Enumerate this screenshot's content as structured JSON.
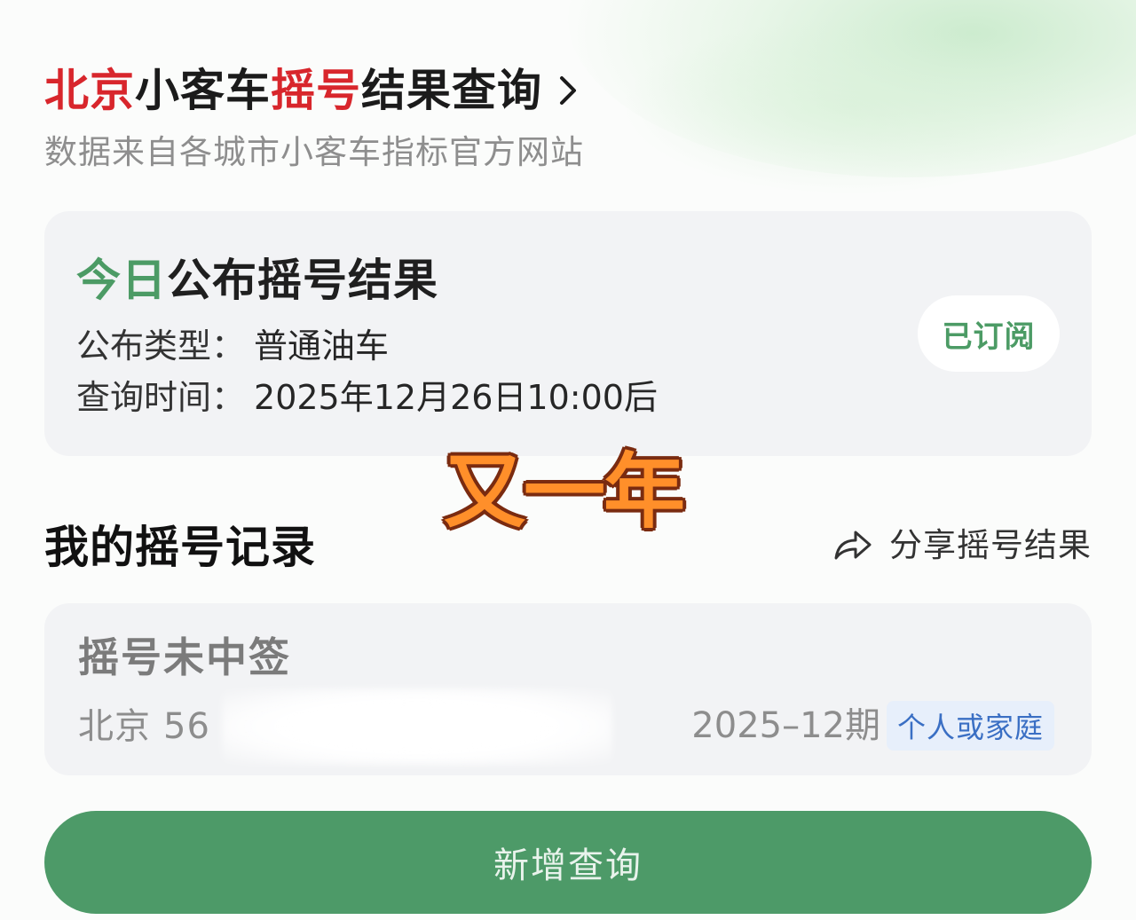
{
  "header": {
    "title_parts": [
      {
        "text": "北京",
        "color": "#d8262c"
      },
      {
        "text": "小客车",
        "color": "#1b1b1b"
      },
      {
        "text": "摇号",
        "color": "#d8262c"
      },
      {
        "text": "结果查询",
        "color": "#1b1b1b"
      }
    ],
    "subtitle": "数据来自各城市小客车指标官方网站"
  },
  "today": {
    "title_highlight": "今日",
    "title_rest": "公布摇号结果",
    "type_label": "公布类型：",
    "type_value": "普通油车",
    "time_label": "查询时间：",
    "time_value": "2025年12月26日10:00后",
    "subscribe_label": "已订阅"
  },
  "overlay": {
    "text": "又一年"
  },
  "records": {
    "title": "我的摇号记录",
    "share_label": "分享摇号结果",
    "items": [
      {
        "status": "摇号未中签",
        "city": "北京",
        "code_visible": "56",
        "period": "2025–12期",
        "tag": "个人或家庭"
      }
    ]
  },
  "actions": {
    "add_query_label": "新增查询"
  },
  "colors": {
    "accent_green": "#4c9b65",
    "accent_red": "#d8262c",
    "tag_blue": "#3a6fc4",
    "button_green": "#4d9a68"
  },
  "icons": {
    "title_chevron": "chevron-right-icon",
    "share": "share-arrow-icon"
  }
}
